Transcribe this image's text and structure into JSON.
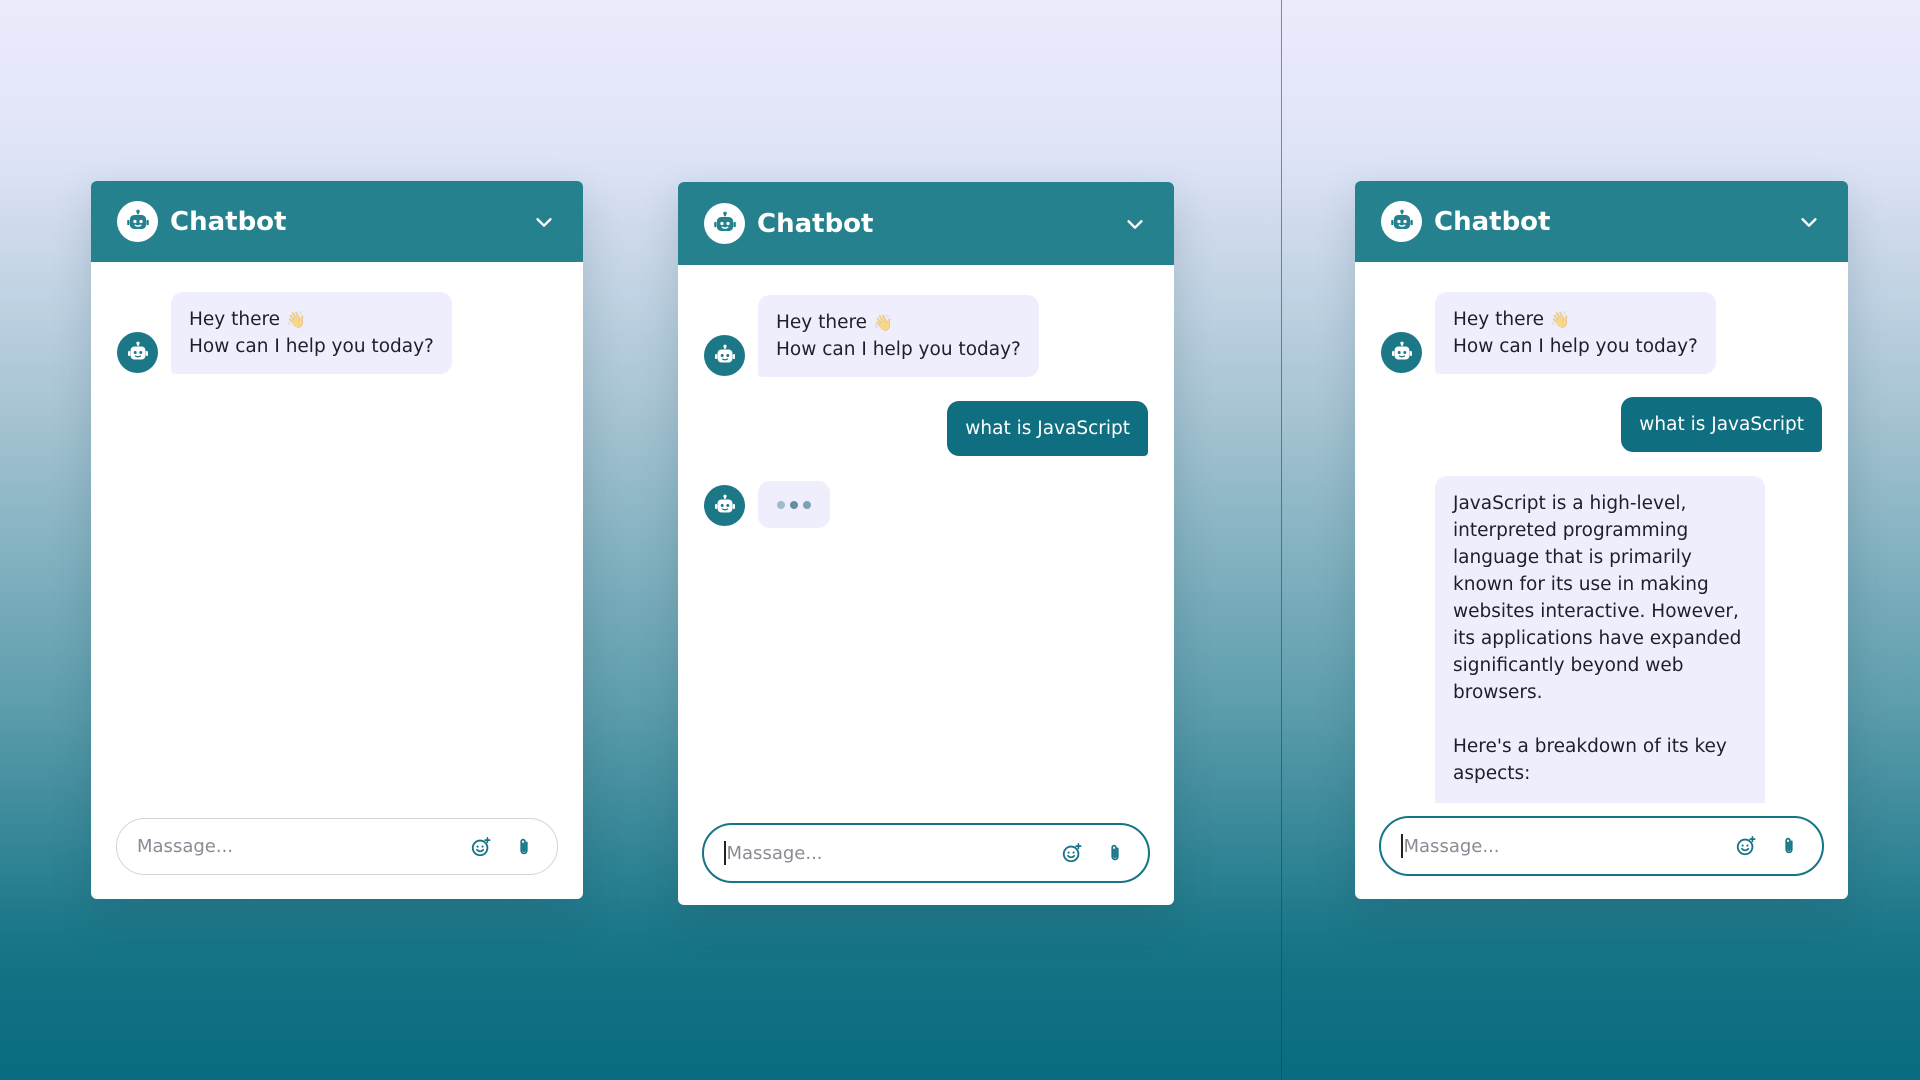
{
  "colors": {
    "header": "#26818f",
    "user_bubble": "#0f6f80",
    "bot_bubble": "#efeefd",
    "bot_avatar": "#1c7887",
    "focused_border": "#157486"
  },
  "icons": {
    "bot": "robot-icon",
    "collapse": "chevron-down-icon",
    "emoji": "smiley-icon",
    "attach": "paperclip-icon"
  },
  "windows": [
    {
      "title": "Chatbot",
      "greeting": {
        "line1": "Hey there",
        "emoji": "👋",
        "line2": "How can I help you today?"
      },
      "input_placeholder": "Massage..."
    },
    {
      "title": "Chatbot",
      "greeting": {
        "line1": "Hey there",
        "emoji": "👋",
        "line2": "How can I help you today?"
      },
      "user_message": "what is JavaScript",
      "typing_indicator": true,
      "input_placeholder": "Massage..."
    },
    {
      "title": "Chatbot",
      "greeting": {
        "line1": "Hey there",
        "emoji": "👋",
        "line2": "How can I help you today?"
      },
      "user_message": "what is JavaScript",
      "bot_answer": {
        "paragraph1": "JavaScript is a high-level, interpreted programming language that is primarily known for its use in making websites interactive. However, its applications have expanded significantly beyond web browsers.",
        "paragraph2": "Here's a breakdown of its key aspects:"
      },
      "input_placeholder": "Massage..."
    }
  ]
}
